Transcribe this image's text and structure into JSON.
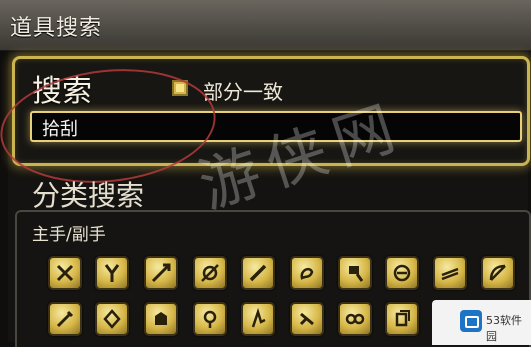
{
  "window": {
    "title": "道具搜索"
  },
  "search": {
    "label": "搜索",
    "partial_match_label": "部分一致",
    "partial_match_checked": true,
    "query": "拾刮"
  },
  "category": {
    "label": "分类搜索",
    "group_label": "主手/副手"
  },
  "icons": [
    {
      "name": "pugilist-icon"
    },
    {
      "name": "marauder-icon"
    },
    {
      "name": "lancer-icon"
    },
    {
      "name": "archer-icon"
    },
    {
      "name": "rogue-icon"
    },
    {
      "name": "scholar-icon"
    },
    {
      "name": "machinist-icon"
    },
    {
      "name": "astrologian-icon"
    },
    {
      "name": "dark-knight-icon"
    },
    {
      "name": "bow-icon"
    },
    {
      "name": "conjurer-icon"
    },
    {
      "name": "thaumaturge-icon"
    },
    {
      "name": "arcanist-icon"
    },
    {
      "name": "carpenter-icon"
    },
    {
      "name": "blacksmith-icon"
    },
    {
      "name": "armorer-icon"
    },
    {
      "name": "goldsmith-icon"
    },
    {
      "name": "leatherworker-icon"
    }
  ],
  "overlay": {
    "watermark_text": "游侠网",
    "badge_text": "53软件园"
  }
}
